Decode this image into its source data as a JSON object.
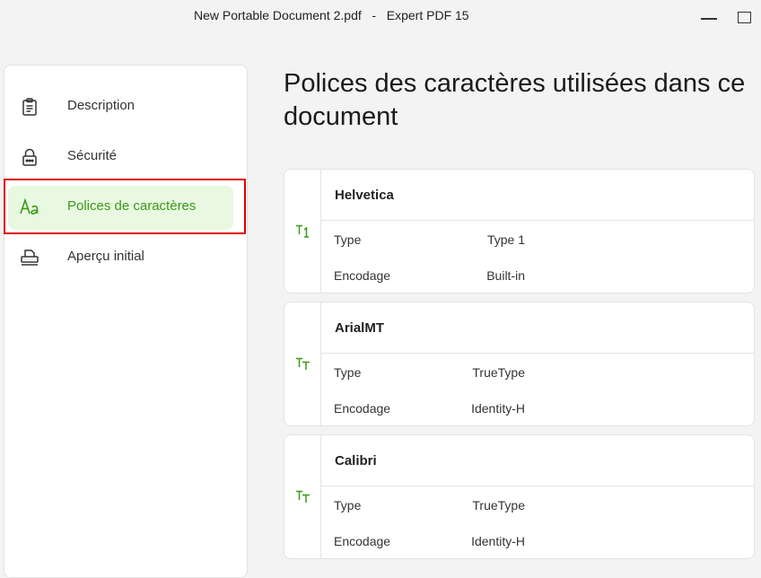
{
  "window": {
    "title": "New Portable Document 2.pdf   -   Expert PDF 15"
  },
  "sidebar": {
    "items": [
      {
        "label": "Description",
        "icon": "clipboard-icon"
      },
      {
        "label": "Sécurité",
        "icon": "lock-icon"
      },
      {
        "label": "Polices de caractères",
        "icon": "font-aa-icon",
        "active": true
      },
      {
        "label": "Aperçu initial",
        "icon": "printer-view-icon"
      }
    ]
  },
  "main": {
    "title": "Polices des caractères utilisées dans ce document",
    "fonts": [
      {
        "name": "Helvetica",
        "icon": "type1-font-icon",
        "type_label": "Type",
        "type_value": "Type 1",
        "encoding_label": "Encodage",
        "encoding_value": "Built-in"
      },
      {
        "name": "ArialMT",
        "icon": "truetype-font-icon",
        "type_label": "Type",
        "type_value": "TrueType",
        "encoding_label": "Encodage",
        "encoding_value": "Identity-H"
      },
      {
        "name": "Calibri",
        "icon": "truetype-font-icon",
        "type_label": "Type",
        "type_value": "TrueType",
        "encoding_label": "Encodage",
        "encoding_value": "Identity-H"
      }
    ]
  },
  "colors": {
    "accent": "#3b9a17",
    "active_bg": "#e8f8e1",
    "selection_frame": "#e00000"
  }
}
